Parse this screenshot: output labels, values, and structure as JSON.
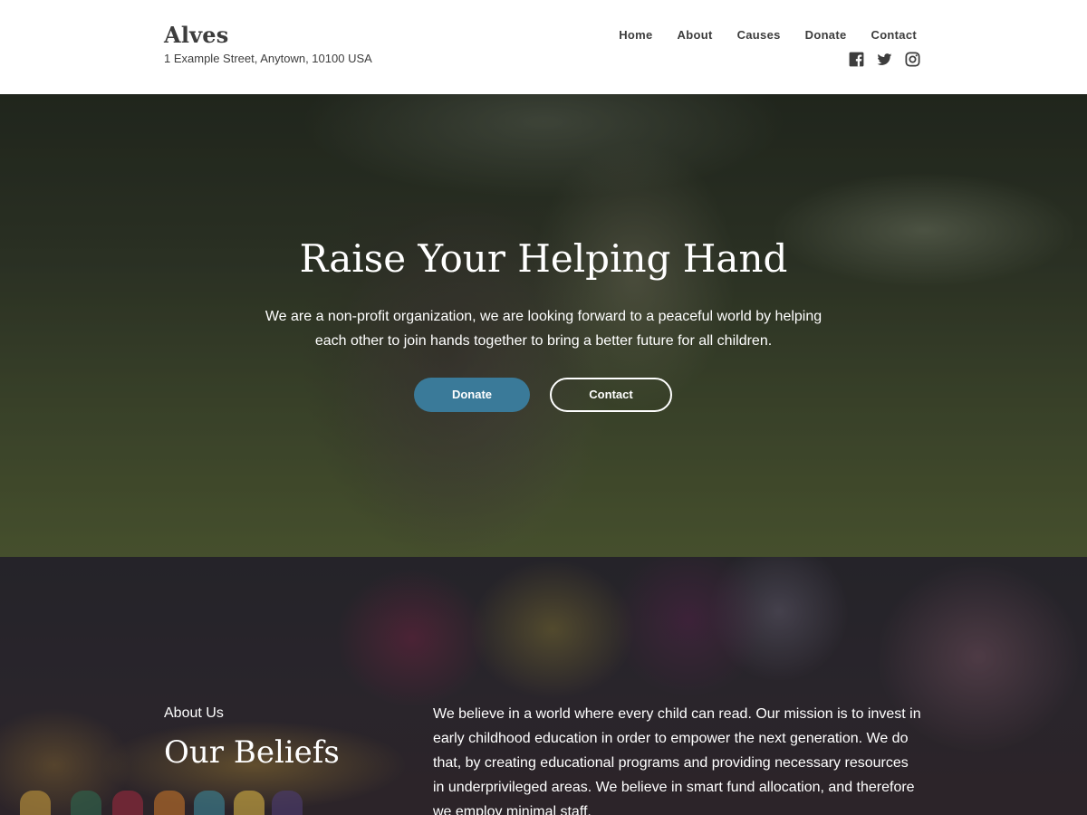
{
  "header": {
    "site_title": "Alves",
    "address": "1 Example Street, Anytown, 10100 USA",
    "nav": [
      "Home",
      "About",
      "Causes",
      "Donate",
      "Contact"
    ],
    "social_icons": [
      "facebook-icon",
      "twitter-icon",
      "instagram-icon"
    ]
  },
  "hero": {
    "title": "Raise Your Helping Hand",
    "text": "We are a non-profit organization, we are looking forward to a peaceful world by helping each other to join hands together to bring a better future for all children.",
    "donate_label": "Donate",
    "contact_label": "Contact",
    "accent_color": "#3a7a99"
  },
  "about": {
    "label": "About Us",
    "heading": "Our Beliefs",
    "text": "We believe in a world where every child can read. Our mission is to invest in early childhood education in order to empower the next generation. We do that, by creating educational programs and providing necessary resources in underprivileged areas. We believe in smart fund allocation, and therefore we employ minimal staff."
  }
}
